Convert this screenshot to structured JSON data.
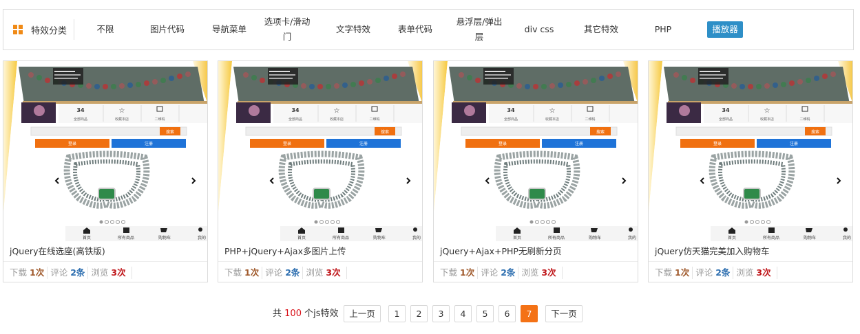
{
  "nav": {
    "title": "特效分类",
    "items": [
      {
        "label": "不限",
        "active": false
      },
      {
        "label": "图片代码",
        "active": false
      },
      {
        "label": "导航菜单",
        "active": false
      },
      {
        "label": "选项卡/滑动门",
        "active": false
      },
      {
        "label": "文字特效",
        "active": false
      },
      {
        "label": "表单代码",
        "active": false
      },
      {
        "label": "悬浮层/弹出层",
        "active": false
      },
      {
        "label": "div css",
        "active": false
      },
      {
        "label": "其它特效",
        "active": false
      },
      {
        "label": "PHP",
        "active": false
      },
      {
        "label": "播放器",
        "active": true
      }
    ]
  },
  "thumbnail": {
    "stat_count": "34",
    "stat_labels": [
      "全部商品",
      "收藏本店",
      "二维码"
    ],
    "search_button": "搜索",
    "login_button": "登录",
    "register_button": "注册",
    "nav_labels": [
      "首页",
      "所有商品",
      "购物车",
      "我的"
    ]
  },
  "cards": [
    {
      "title": "jQuery在线选座(高铁版)",
      "downloads": "1次",
      "comments": "2条",
      "views": "3次"
    },
    {
      "title": "PHP+jQuery+Ajax多图片上传",
      "downloads": "1次",
      "comments": "2条",
      "views": "3次"
    },
    {
      "title": "jQuery+Ajax+PHP无刷新分页",
      "downloads": "1次",
      "comments": "2条",
      "views": "3次"
    },
    {
      "title": "jQuery仿天猫完美加入购物车",
      "downloads": "1次",
      "comments": "2条",
      "views": "3次"
    }
  ],
  "labels": {
    "download": "下载",
    "comment": "评论",
    "view": "浏览"
  },
  "pagination": {
    "total_prefix": "共",
    "total_count": "100",
    "total_suffix": "个js特效",
    "prev": "上一页",
    "next": "下一页",
    "pages": [
      "1",
      "2",
      "3",
      "4",
      "5",
      "6",
      "7"
    ],
    "current": "7"
  },
  "colors": {
    "accent_orange": "#f47216",
    "active_blue": "#2e8fc7",
    "download_brown": "#a05a2c",
    "comment_blue": "#2e6fb0",
    "view_red": "#c0181c"
  }
}
